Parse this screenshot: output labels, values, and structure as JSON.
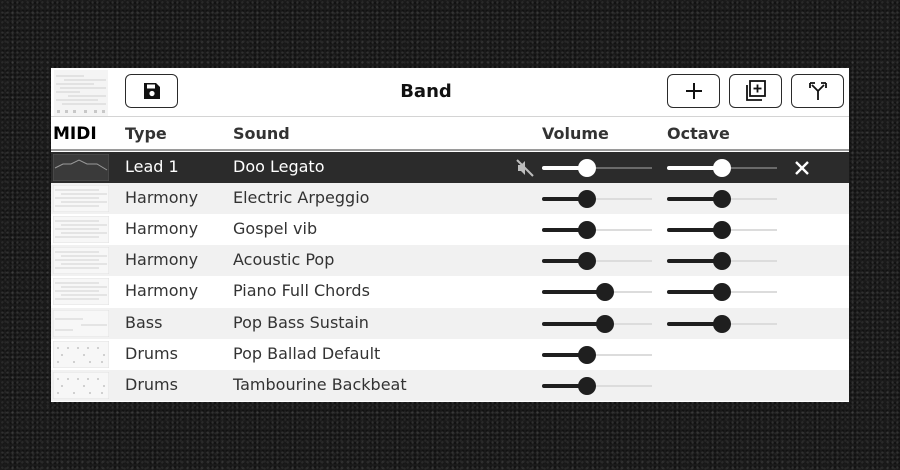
{
  "toolbar": {
    "title": "Band",
    "icons": {
      "save": "save-icon",
      "add": "plus-icon",
      "duplicate": "duplicate-icon",
      "split": "split-icon"
    }
  },
  "columns": {
    "midi": "MIDI",
    "type": "Type",
    "sound": "Sound",
    "volume": "Volume",
    "octave": "Octave"
  },
  "tracks": [
    {
      "type": "Lead 1",
      "sound": "Doo Legato",
      "volume": 0.41,
      "octave": 0.5,
      "selected": true,
      "muted": true,
      "thumb": "lead"
    },
    {
      "type": "Harmony",
      "sound": "Electric Arpeggio",
      "volume": 0.41,
      "octave": 0.5,
      "thumb": "harmony"
    },
    {
      "type": "Harmony",
      "sound": "Gospel vib",
      "volume": 0.41,
      "octave": 0.5,
      "thumb": "harmony"
    },
    {
      "type": "Harmony",
      "sound": "Acoustic Pop",
      "volume": 0.41,
      "octave": 0.5,
      "thumb": "harmony"
    },
    {
      "type": "Harmony",
      "sound": "Piano Full Chords",
      "volume": 0.57,
      "octave": 0.5,
      "thumb": "harmony"
    },
    {
      "type": "Bass",
      "sound": "Pop Bass Sustain",
      "volume": 0.57,
      "octave": 0.5,
      "thumb": "bass"
    },
    {
      "type": "Drums",
      "sound": "Pop Ballad Default",
      "volume": 0.41,
      "octave": null,
      "thumb": "drums"
    },
    {
      "type": "Drums",
      "sound": "Tambourine Backbeat",
      "volume": 0.41,
      "octave": null,
      "thumb": "drums"
    }
  ],
  "colors": {
    "selected_row": "#2b2b2b",
    "alt_row": "#f1f1f1",
    "slider_fill": "#1f1f1f",
    "slider_track": "#dcdcdc"
  }
}
